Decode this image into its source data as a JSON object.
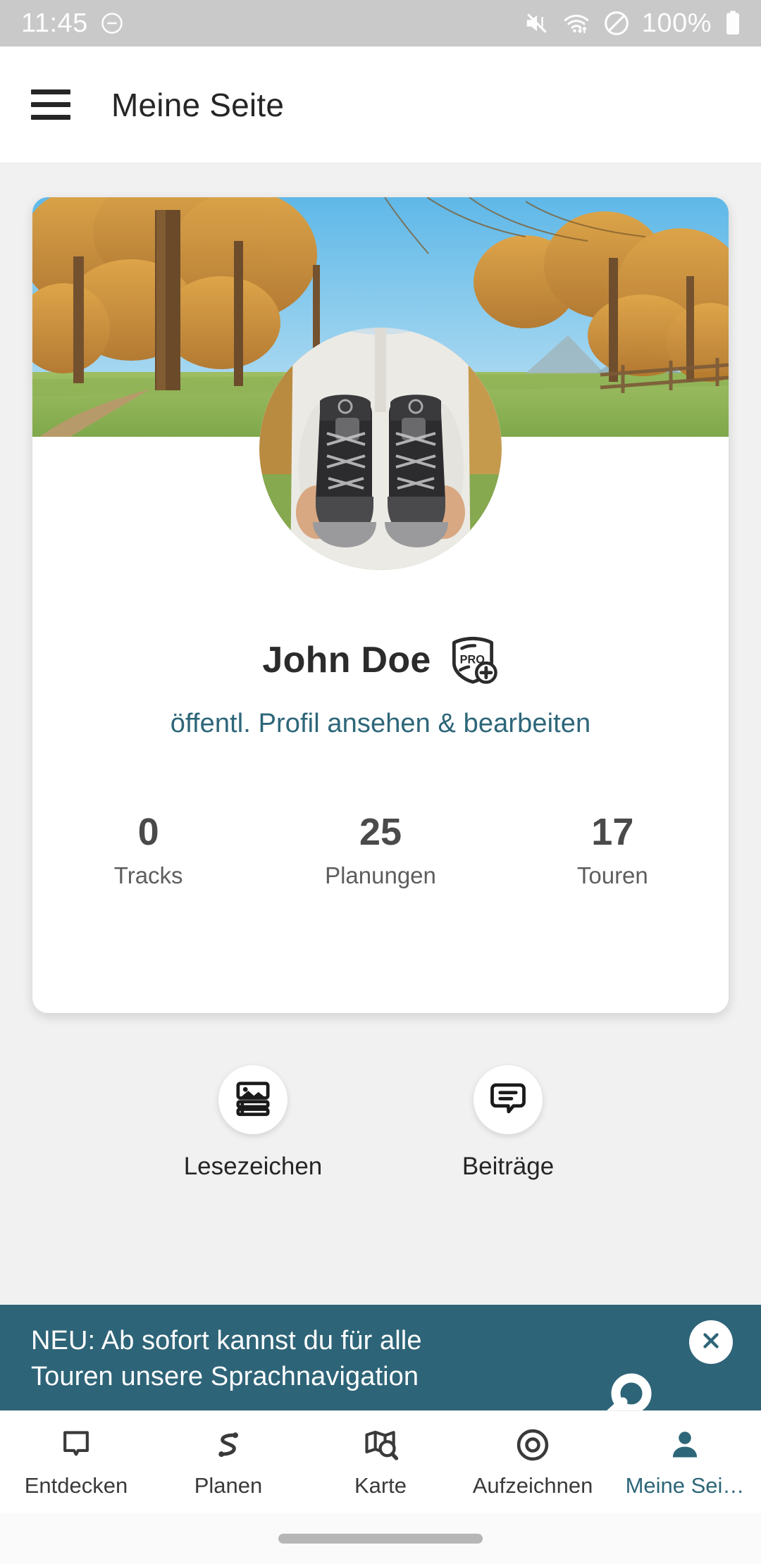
{
  "status_bar": {
    "time": "11:45",
    "battery_percent": "100%",
    "icons": [
      "dnd-minus-icon",
      "mute-vibrate-icon",
      "wifi-icon",
      "do-not-disturb-icon",
      "battery-icon"
    ]
  },
  "app_bar": {
    "menu_icon": "hamburger-menu-icon",
    "title": "Meine Seite"
  },
  "profile": {
    "cover_photo_alt": "autumn larch forest with trail",
    "avatar_alt": "hands holding hiking boots",
    "name": "John Doe",
    "badge": "PRO+",
    "profile_link": "öffentl. Profil ansehen & bearbeiten",
    "stats": [
      {
        "value": "0",
        "label": "Tracks"
      },
      {
        "value": "25",
        "label": "Planungen"
      },
      {
        "value": "17",
        "label": "Touren"
      }
    ]
  },
  "quick_actions": [
    {
      "icon": "bookmark-list-icon",
      "label": "Lesezeichen"
    },
    {
      "icon": "speech-bubble-icon",
      "label": "Beiträge"
    }
  ],
  "promo_banner": {
    "line1": "NEU: Ab sofort kannst du für alle",
    "line2": "Touren unsere Sprachnavigation",
    "close_icon": "close-icon",
    "decoration_icon": "headset-icon",
    "background_color": "#2e6478"
  },
  "bottom_nav": {
    "items": [
      {
        "icon": "discover-bookmark-icon",
        "label": "Entdecken",
        "active": false
      },
      {
        "icon": "route-plan-icon",
        "label": "Planen",
        "active": false
      },
      {
        "icon": "map-search-icon",
        "label": "Karte",
        "active": false
      },
      {
        "icon": "record-circle-icon",
        "label": "Aufzeichnen",
        "active": false
      },
      {
        "icon": "person-icon",
        "label": "Meine Sei…",
        "active": true
      }
    ],
    "active_color": "#2d6679"
  },
  "colors": {
    "accent": "#2d6679",
    "page_background": "#f1f1f1",
    "card_background": "#ffffff",
    "status_bar": "#c9c9c9"
  }
}
